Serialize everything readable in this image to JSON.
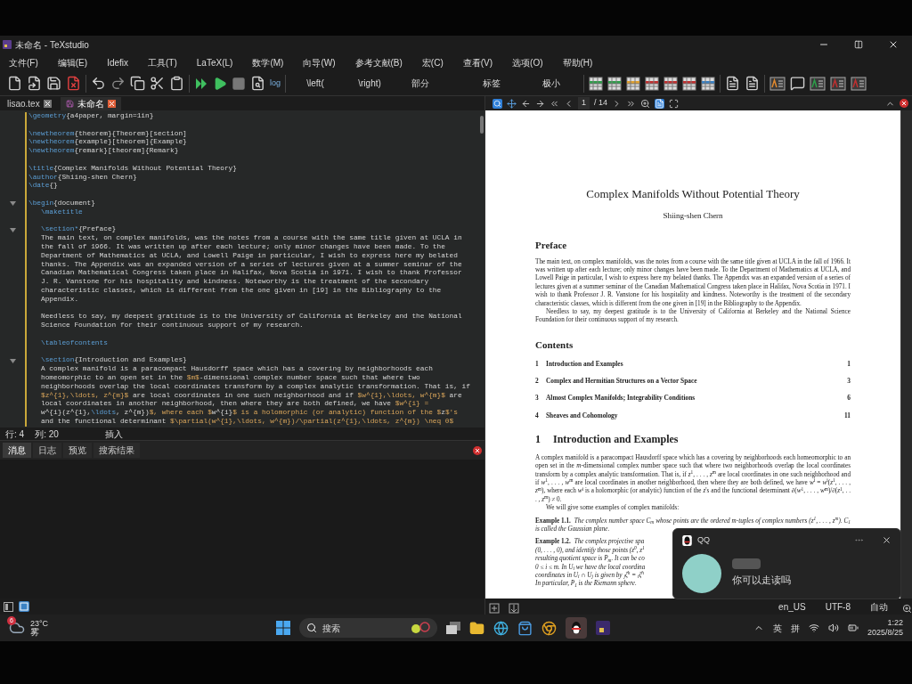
{
  "window": {
    "title": "未命名 - TeXstudio"
  },
  "menu": [
    "文件(F)",
    "编辑(E)",
    "Idefix",
    "工具(T)",
    "LaTeX(L)",
    "数学(M)",
    "向导(W)",
    "参考文献(B)",
    "宏(C)",
    "查看(V)",
    "选项(O)",
    "帮助(H)"
  ],
  "toolbar": {
    "log_label": "log",
    "texts": [
      "\\left(",
      "\\right)",
      "部分",
      "标签",
      "极小"
    ]
  },
  "editor_tabs": [
    {
      "label": "lisao.tex",
      "selected": false
    },
    {
      "label": "未命名",
      "selected": true
    }
  ],
  "editor": {
    "lines": [
      {
        "text": "\\geometry{a4paper, margin=1in}"
      },
      {
        "text": "\\newtheorem{theorem}{Theorem}[section]",
        "gap_before": true
      },
      {
        "text": "\\newtheorem{example}[theorem]{Example}"
      },
      {
        "text": "\\newtheorem{remark}[theorem]{Remark}"
      },
      {
        "text": "\\title{Complex Manifolds Without Potential Theory}",
        "gap_before": true
      },
      {
        "text": "\\author{Shiing-shen Chern}"
      },
      {
        "text": "\\date{}"
      },
      {
        "text": "\\begin{document}",
        "gap_before": true,
        "fold": true,
        "children": [
          {
            "text": "\\maketitle"
          },
          {
            "text": "\\section*{Preface}",
            "gap_before": true,
            "fold": true
          },
          {
            "text": "The main text, on complex manifolds, was the notes from a course with the same title given at UCLA in"
          },
          {
            "text": "the fall of 1966. It was written up after each lecture; only minor changes have been made. To the"
          },
          {
            "text": "Department of Mathematics at UCLA, and Lowell Paige in particular, I wish to express here my belated"
          },
          {
            "text": "thanks. The Appendix was an expanded version of a series of lectures given at a summer seminar of the"
          },
          {
            "text": "Canadian Mathematical Congress taken place in Halifax, Nova Scotia in 1971. I wish to thank Professor"
          },
          {
            "text": "J. R. Vanstone for his hospitality and kindness. Noteworthy is the treatment of the secondary"
          },
          {
            "text": "characteristic classes, which is different from the one given in [19] in the Bibliography to the"
          },
          {
            "text": "Appendix."
          },
          {
            "text": "Needless to say, my deepest gratitude is to the University of California at Berkeley and the National",
            "gap_before": true
          },
          {
            "text": "Science Foundation for their continuous support of my research."
          },
          {
            "text": "\\tableofcontents",
            "gap_before": true
          },
          {
            "text": "\\section{Introduction and Examples}",
            "gap_before": true,
            "fold": true
          },
          {
            "text": "A complex manifold is a paracompact Hausdorff space which has a covering by neighborhoods each"
          },
          {
            "text": "homeomorphic to an open set in the $m$-dimensional complex number space such that where two"
          },
          {
            "text": "neighborhoods overlap the local coordinates transform by a complex analytic transformation. That is, if"
          },
          {
            "text": "$z^{1},\\ldots, z^{m}$ are local coordinates in one such neighborhood and if $w^{1},\\ldots, w^{m}$ are"
          },
          {
            "text": "local coordinates in another neighborhood, then where they are both defined, we have $w^{i} ="
          },
          {
            "text": "w^{i}(z^{1},\\ldots, z^{m})$, where each $w^{i}$ is a holomorphic (or analytic) function of the $z$'s"
          },
          {
            "text": "and the functional determinant $\\partial(w^{1},\\ldots, w^{m})/\\partial(z^{1},\\ldots, z^{m}) \\neq 0$"
          }
        ]
      }
    ]
  },
  "status": {
    "line": "行: 4",
    "column": "列: 20",
    "mode": "插入"
  },
  "panel_tabs": [
    {
      "label": "消息",
      "selected": true
    },
    {
      "label": "日志",
      "selected": false
    },
    {
      "label": "预览",
      "selected": false
    },
    {
      "label": "搜索结果",
      "selected": false
    }
  ],
  "pdf_toolbar": {
    "page": "1",
    "total": "/ 14"
  },
  "pdf": {
    "title": "Complex Manifolds Without Potential Theory",
    "author": "Shiing-shen Chern",
    "preface_heading": "Preface",
    "preface": [
      "The main text, on complex manifolds, was the notes from a course with the same title given at UCLA in the fall of 1966. It was written up after each lecture; only minor changes have been made. To the Department of Mathematics at UCLA, and Lowell Paige in particular, I wish to express here my belated thanks. The Appendix was an expanded version of a series of lectures given at a summer seminar of the Canadian Mathematical Congress taken place in Halifax, Nova Scotia in 1971. I wish to thank Professor J. R. Vanstone for his hospitality and kindness. Noteworthy is the treatment of the secondary characteristic classes, which is different from the one given in [19] in the Bibliography to the Appendix.",
      "Needless to say, my deepest gratitude is to the University of California at Berkeley and the National Science Foundation for their continuous support of my research."
    ],
    "contents_heading": "Contents",
    "contents": [
      {
        "number": "1",
        "title": "Introduction and Examples",
        "page": "1"
      },
      {
        "number": "2",
        "title": "Complex and Hermitian Structures on a Vector Space",
        "page": "3"
      },
      {
        "number": "3",
        "title": "Almost Complex Manifolds; Integrability Conditions",
        "page": "6"
      },
      {
        "number": "4",
        "title": "Sheaves and Cohomology",
        "page": "11"
      }
    ],
    "section_number": "1",
    "section_title": "Introduction and Examples",
    "section_text": [
      "A complex manifold is a paracompact Hausdorff space which has a covering by neighborhoods each homeomorphic to an open set in the *m*-dimensional complex number space such that where two neighborhoods overlap the local coordinates transform by a complex analytic transformation. That is, if *z*$^{1}$, . . . , *z*$^{m}$ are local coordinates in one such neighborhood and if *w*$^{1}$, . . . , *w*$^{m}$ are local coordinates in another neighborhood, then where they are both defined, we have *w*$^{i}$ = *w*$^{i}$(*z*$^{1}$, . . . , *z*$^{m}$), where each *w*$^{i}$ is a holomorphic (or analytic) function of the *z*'s and the functional determinant ∂(*w*$^{1}$, . . . , *w*$^{m}$)/∂(*z*$^{1}$, . . . , *z*$^{m}$) ≠ 0.",
      "We will give some examples of complex manifolds:"
    ],
    "examples": [
      {
        "label": "Example 1.1.",
        "lines": [
          "The complex number space C$_{m}$ whose points are the ordered m-tuples of complex numbers (z$^{1}$, . . . , z$^{m}$). C$_{1}$ is called the Gaussian plane."
        ]
      },
      {
        "label": "Example 1.2.",
        "lines": [
          "The complex projective spa",
          "(0, . . . , 0), and identify those points (z$^{0}$, z$^{1}$",
          "resulting quotient space is P$_{m}$. It can be co",
          "0 ≤ i ≤ m. In U$_{i}$ we have the local coordina",
          "coordinates in U$_{i}$ ∩ U$_{j}$ is given by $_{j}$ζ$^{h}$ = $_{i}$ζ$^{h}$",
          "In particular, P$_{1}$ is the Riemann sphere."
        ]
      }
    ]
  },
  "status_bar": [
    "en_US",
    "UTF-8",
    "自动"
  ],
  "notification": {
    "app": "QQ",
    "message": "你可以走读吗"
  },
  "taskbar": {
    "temperature": "23°C",
    "weather": "雾",
    "weather_badge": "6",
    "search_placeholder": "搜索",
    "ime_language": "英",
    "ime_mode": "拼",
    "time": "1:22",
    "date": "2025/8/25"
  }
}
